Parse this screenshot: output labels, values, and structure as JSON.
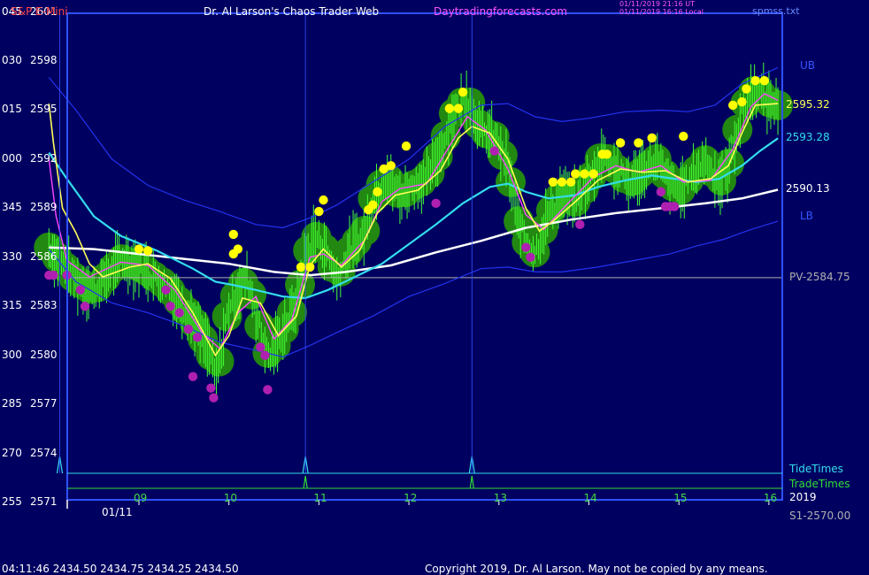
{
  "header": {
    "title_left": "S&P E-Mini",
    "title_center": "Dr. Al Larson's Chaos Trader Web",
    "title_site": "Daytradingforecasts.com",
    "timestamp_line1": "01/11/2019 21:16 UT",
    "timestamp_line2": "01/11/2019 16:16 Local",
    "filename": "spmss.txt"
  },
  "footer": {
    "quote": "04:11:46  2434.50  2434.75  2434.25  2434.50",
    "copyright": "Copyright 2019, Dr. Al Larson. May not be copied by any means."
  },
  "colors": {
    "background": "#000060",
    "frame": "#3050ff",
    "price_bars": "#44ff33",
    "halo": "#228811",
    "yellow_dots": "#ffff00",
    "magenta_dots": "#b020b0",
    "fast_ma": "#ffff55",
    "pink_ma": "#ff44ff",
    "cyan_ma": "#33ddee",
    "white_ma": "#ffffff",
    "bands": "#2233ee",
    "pivot": "#b0b0b0",
    "tide": "#33ddee",
    "trade": "#33dd33"
  },
  "chart_data": {
    "type": "line",
    "title": "S&P E-Mini",
    "y_axis": {
      "ticks": [
        {
          "left": "045",
          "right": "2601"
        },
        {
          "left": "030",
          "right": "2598"
        },
        {
          "left": "015",
          "right": "2595"
        },
        {
          "left": "000",
          "right": "2592"
        },
        {
          "left": "345",
          "right": "2589"
        },
        {
          "left": "330",
          "right": "2586"
        },
        {
          "left": "315",
          "right": "2583"
        },
        {
          "left": "300",
          "right": "2580"
        },
        {
          "left": "285",
          "right": "2577"
        },
        {
          "left": "270",
          "right": "2574"
        },
        {
          "left": "255",
          "right": "2571"
        }
      ],
      "range": [
        2571,
        2601
      ]
    },
    "x_axis": {
      "ticks": [
        {
          "label": "09",
          "value": 9
        },
        {
          "label": "10",
          "value": 10
        },
        {
          "label": "11",
          "value": 11
        },
        {
          "label": "12",
          "value": 12
        },
        {
          "label": "13",
          "value": 13
        },
        {
          "label": "14",
          "value": 14
        },
        {
          "label": "15",
          "value": 15
        },
        {
          "label": "16",
          "value": 16
        }
      ],
      "date_label": "01/11",
      "range": [
        8.0,
        16.1
      ]
    },
    "price_path": [
      [
        8.0,
        2586.6
      ],
      [
        8.3,
        2584.6
      ],
      [
        8.5,
        2583.9
      ],
      [
        8.8,
        2585.9
      ],
      [
        9.05,
        2585.3
      ],
      [
        9.3,
        2584.3
      ],
      [
        9.6,
        2582.2
      ],
      [
        9.8,
        2580.0
      ],
      [
        9.85,
        2578.4
      ],
      [
        10.0,
        2583.0
      ],
      [
        10.2,
        2584.8
      ],
      [
        10.35,
        2581.6
      ],
      [
        10.45,
        2579.8
      ],
      [
        10.6,
        2581.5
      ],
      [
        10.75,
        2583.2
      ],
      [
        10.85,
        2586.0
      ],
      [
        10.95,
        2587.4
      ],
      [
        11.1,
        2586.2
      ],
      [
        11.2,
        2584.6
      ],
      [
        11.35,
        2586.6
      ],
      [
        11.5,
        2587.4
      ],
      [
        11.6,
        2589.6
      ],
      [
        11.75,
        2591.0
      ],
      [
        11.9,
        2589.7
      ],
      [
        12.05,
        2590.4
      ],
      [
        12.2,
        2590.8
      ],
      [
        12.35,
        2592.5
      ],
      [
        12.5,
        2594.8
      ],
      [
        12.65,
        2595.9
      ],
      [
        12.8,
        2593.7
      ],
      [
        12.95,
        2593.4
      ],
      [
        13.1,
        2591.5
      ],
      [
        13.2,
        2588.5
      ],
      [
        13.3,
        2587.0
      ],
      [
        13.4,
        2586.3
      ],
      [
        13.55,
        2588.6
      ],
      [
        13.7,
        2589.9
      ],
      [
        13.85,
        2589.4
      ],
      [
        14.0,
        2590.6
      ],
      [
        14.15,
        2592.4
      ],
      [
        14.3,
        2591.4
      ],
      [
        14.45,
        2590.5
      ],
      [
        14.6,
        2591.3
      ],
      [
        14.75,
        2592.0
      ],
      [
        14.9,
        2590.5
      ],
      [
        15.0,
        2590.0
      ],
      [
        15.15,
        2591.0
      ],
      [
        15.3,
        2592.0
      ],
      [
        15.45,
        2590.5
      ],
      [
        15.55,
        2591.5
      ],
      [
        15.65,
        2593.8
      ],
      [
        15.75,
        2595.6
      ],
      [
        15.85,
        2596.3
      ],
      [
        16.0,
        2595.5
      ],
      [
        16.1,
        2595.3
      ]
    ],
    "series": [
      {
        "name": "Fast MA",
        "points": [
          [
            8.0,
            2595.4
          ],
          [
            8.05,
            2593.0
          ],
          [
            8.15,
            2589.0
          ],
          [
            8.3,
            2587.5
          ],
          [
            8.45,
            2585.6
          ],
          [
            8.6,
            2584.8
          ],
          [
            8.9,
            2585.4
          ],
          [
            9.1,
            2585.6
          ],
          [
            9.35,
            2584.7
          ],
          [
            9.6,
            2582.6
          ],
          [
            9.85,
            2580.0
          ],
          [
            10.0,
            2581.2
          ],
          [
            10.15,
            2583.5
          ],
          [
            10.35,
            2583.2
          ],
          [
            10.55,
            2581.2
          ],
          [
            10.75,
            2582.4
          ],
          [
            10.9,
            2585.5
          ],
          [
            11.05,
            2586.5
          ],
          [
            11.25,
            2585.4
          ],
          [
            11.45,
            2586.4
          ],
          [
            11.65,
            2588.7
          ],
          [
            11.85,
            2589.8
          ],
          [
            12.1,
            2590.1
          ],
          [
            12.35,
            2591.3
          ],
          [
            12.55,
            2593.3
          ],
          [
            12.7,
            2594.0
          ],
          [
            12.9,
            2593.6
          ],
          [
            13.1,
            2592.0
          ],
          [
            13.3,
            2589.0
          ],
          [
            13.45,
            2587.6
          ],
          [
            13.6,
            2588.2
          ],
          [
            13.85,
            2589.4
          ],
          [
            14.1,
            2590.7
          ],
          [
            14.35,
            2591.4
          ],
          [
            14.6,
            2591.2
          ],
          [
            14.85,
            2591.3
          ],
          [
            15.1,
            2590.6
          ],
          [
            15.35,
            2590.8
          ],
          [
            15.55,
            2591.6
          ],
          [
            15.7,
            2593.6
          ],
          [
            15.85,
            2595.3
          ],
          [
            16.1,
            2595.4
          ]
        ]
      },
      {
        "name": "Pink MA",
        "points": [
          [
            8.0,
            2592.0
          ],
          [
            8.08,
            2588.5
          ],
          [
            8.2,
            2585.8
          ],
          [
            8.45,
            2584.8
          ],
          [
            8.8,
            2585.7
          ],
          [
            9.1,
            2585.5
          ],
          [
            9.4,
            2584.0
          ],
          [
            9.7,
            2581.4
          ],
          [
            9.9,
            2580.4
          ],
          [
            10.1,
            2582.6
          ],
          [
            10.3,
            2583.6
          ],
          [
            10.5,
            2581.0
          ],
          [
            10.7,
            2582.2
          ],
          [
            10.9,
            2586.0
          ],
          [
            11.05,
            2586.2
          ],
          [
            11.25,
            2585.5
          ],
          [
            11.5,
            2587.0
          ],
          [
            11.7,
            2589.4
          ],
          [
            11.9,
            2590.2
          ],
          [
            12.2,
            2590.5
          ],
          [
            12.45,
            2592.8
          ],
          [
            12.65,
            2594.6
          ],
          [
            12.85,
            2593.8
          ],
          [
            13.1,
            2591.4
          ],
          [
            13.3,
            2588.6
          ],
          [
            13.5,
            2587.7
          ],
          [
            13.75,
            2589.2
          ],
          [
            14.05,
            2590.9
          ],
          [
            14.3,
            2591.6
          ],
          [
            14.55,
            2591.2
          ],
          [
            14.8,
            2591.6
          ],
          [
            15.05,
            2590.6
          ],
          [
            15.35,
            2590.7
          ],
          [
            15.6,
            2592.6
          ],
          [
            15.8,
            2595.2
          ],
          [
            15.95,
            2596.0
          ],
          [
            16.1,
            2595.6
          ]
        ]
      },
      {
        "name": "Cyan MA",
        "points": [
          [
            8.0,
            2592.4
          ],
          [
            8.2,
            2590.8
          ],
          [
            8.5,
            2588.5
          ],
          [
            8.8,
            2587.3
          ],
          [
            9.2,
            2586.4
          ],
          [
            9.6,
            2585.3
          ],
          [
            9.85,
            2584.5
          ],
          [
            10.05,
            2584.3
          ],
          [
            10.3,
            2584.0
          ],
          [
            10.6,
            2583.6
          ],
          [
            10.85,
            2583.5
          ],
          [
            11.1,
            2584.0
          ],
          [
            11.4,
            2584.8
          ],
          [
            11.7,
            2585.6
          ],
          [
            12.0,
            2586.8
          ],
          [
            12.3,
            2588.0
          ],
          [
            12.6,
            2589.3
          ],
          [
            12.9,
            2590.3
          ],
          [
            13.1,
            2590.5
          ],
          [
            13.3,
            2590.0
          ],
          [
            13.55,
            2589.6
          ],
          [
            13.85,
            2589.8
          ],
          [
            14.1,
            2590.3
          ],
          [
            14.4,
            2590.7
          ],
          [
            14.7,
            2591.0
          ],
          [
            14.95,
            2590.8
          ],
          [
            15.2,
            2590.6
          ],
          [
            15.45,
            2590.8
          ],
          [
            15.7,
            2591.6
          ],
          [
            15.9,
            2592.5
          ],
          [
            16.1,
            2593.28
          ]
        ]
      },
      {
        "name": "White MA",
        "points": [
          [
            8.0,
            2586.6
          ],
          [
            8.5,
            2586.5
          ],
          [
            9.0,
            2586.2
          ],
          [
            9.5,
            2585.9
          ],
          [
            10.0,
            2585.6
          ],
          [
            10.5,
            2585.1
          ],
          [
            10.9,
            2584.9
          ],
          [
            11.3,
            2585.1
          ],
          [
            11.8,
            2585.5
          ],
          [
            12.3,
            2586.3
          ],
          [
            12.8,
            2587.0
          ],
          [
            13.3,
            2587.8
          ],
          [
            13.8,
            2588.3
          ],
          [
            14.3,
            2588.7
          ],
          [
            14.8,
            2589.0
          ],
          [
            15.3,
            2589.3
          ],
          [
            15.7,
            2589.6
          ],
          [
            16.1,
            2590.13
          ]
        ]
      },
      {
        "name": "UB",
        "points": [
          [
            8.0,
            2597.0
          ],
          [
            8.3,
            2595.0
          ],
          [
            8.7,
            2592.0
          ],
          [
            9.1,
            2590.4
          ],
          [
            9.5,
            2589.5
          ],
          [
            9.9,
            2588.8
          ],
          [
            10.3,
            2588.0
          ],
          [
            10.6,
            2587.8
          ],
          [
            10.9,
            2588.4
          ],
          [
            11.2,
            2589.2
          ],
          [
            11.6,
            2590.6
          ],
          [
            12.0,
            2592.0
          ],
          [
            12.4,
            2594.0
          ],
          [
            12.8,
            2595.3
          ],
          [
            13.1,
            2595.4
          ],
          [
            13.4,
            2594.6
          ],
          [
            13.7,
            2594.3
          ],
          [
            14.0,
            2594.5
          ],
          [
            14.4,
            2594.9
          ],
          [
            14.8,
            2595.0
          ],
          [
            15.1,
            2594.9
          ],
          [
            15.4,
            2595.3
          ],
          [
            15.7,
            2596.6
          ],
          [
            16.1,
            2597.6
          ]
        ]
      },
      {
        "name": "LB",
        "points": [
          [
            8.0,
            2586.5
          ],
          [
            8.3,
            2584.5
          ],
          [
            8.7,
            2583.2
          ],
          [
            9.1,
            2582.6
          ],
          [
            9.5,
            2581.8
          ],
          [
            9.9,
            2580.8
          ],
          [
            10.3,
            2580.3
          ],
          [
            10.6,
            2579.9
          ],
          [
            10.9,
            2580.6
          ],
          [
            11.2,
            2581.4
          ],
          [
            11.6,
            2582.4
          ],
          [
            12.0,
            2583.6
          ],
          [
            12.4,
            2584.4
          ],
          [
            12.8,
            2585.3
          ],
          [
            13.1,
            2585.4
          ],
          [
            13.4,
            2585.1
          ],
          [
            13.7,
            2585.1
          ],
          [
            14.1,
            2585.4
          ],
          [
            14.5,
            2585.8
          ],
          [
            14.9,
            2586.2
          ],
          [
            15.2,
            2586.7
          ],
          [
            15.5,
            2587.1
          ],
          [
            15.8,
            2587.7
          ],
          [
            16.1,
            2588.2
          ]
        ]
      }
    ],
    "pivot_line": {
      "label": "PV-2584.75",
      "value": 2584.75
    },
    "right_labels": [
      {
        "text": "UB",
        "value": 2597.7
      },
      {
        "text": "2595.32",
        "value": 2595.32
      },
      {
        "text": "2593.28",
        "value": 2593.28
      },
      {
        "text": "2590.13",
        "value": 2590.13
      },
      {
        "text": "LB",
        "value": 2588.5
      }
    ],
    "tide_times": {
      "label": "TideTimes",
      "spikes": [
        8.12,
        10.85,
        12.7
      ]
    },
    "trade_times": {
      "label": "TradeTimes",
      "year_label": "2019",
      "spikes": [
        10.85,
        12.7
      ]
    },
    "support_label": "S1-2570.00",
    "yellow_dots": [
      [
        9.0,
        2586.5
      ],
      [
        9.1,
        2586.4
      ],
      [
        10.05,
        2586.2
      ],
      [
        10.1,
        2586.5
      ],
      [
        10.05,
        2587.4
      ],
      [
        10.8,
        2585.4
      ],
      [
        10.9,
        2585.4
      ],
      [
        11.0,
        2588.8
      ],
      [
        11.05,
        2589.5
      ],
      [
        11.55,
        2588.9
      ],
      [
        11.6,
        2589.2
      ],
      [
        11.65,
        2590.0
      ],
      [
        11.72,
        2591.4
      ],
      [
        11.8,
        2591.6
      ],
      [
        11.97,
        2592.8
      ],
      [
        12.45,
        2595.1
      ],
      [
        12.55,
        2595.1
      ],
      [
        12.6,
        2596.1
      ],
      [
        13.6,
        2590.6
      ],
      [
        13.7,
        2590.6
      ],
      [
        13.8,
        2590.6
      ],
      [
        13.85,
        2591.1
      ],
      [
        13.95,
        2591.1
      ],
      [
        14.05,
        2591.1
      ],
      [
        14.15,
        2592.3
      ],
      [
        14.2,
        2592.3
      ],
      [
        14.35,
        2593.0
      ],
      [
        14.55,
        2593.0
      ],
      [
        14.7,
        2593.3
      ],
      [
        15.05,
        2593.4
      ],
      [
        15.6,
        2595.3
      ],
      [
        15.7,
        2595.5
      ],
      [
        15.75,
        2596.3
      ],
      [
        15.85,
        2596.8
      ],
      [
        15.95,
        2596.8
      ]
    ],
    "magenta_dots": [
      [
        8.0,
        2584.9
      ],
      [
        8.05,
        2584.9
      ],
      [
        8.2,
        2584.9
      ],
      [
        8.35,
        2584.0
      ],
      [
        8.4,
        2583.0
      ],
      [
        9.3,
        2584.0
      ],
      [
        9.35,
        2583.0
      ],
      [
        9.45,
        2582.6
      ],
      [
        9.55,
        2581.6
      ],
      [
        9.65,
        2581.1
      ],
      [
        9.6,
        2578.7
      ],
      [
        9.8,
        2578.0
      ],
      [
        9.83,
        2577.4
      ],
      [
        10.35,
        2580.5
      ],
      [
        10.4,
        2580.0
      ],
      [
        10.43,
        2577.9
      ],
      [
        12.3,
        2589.3
      ],
      [
        12.95,
        2592.5
      ],
      [
        13.3,
        2586.6
      ],
      [
        13.35,
        2586.0
      ],
      [
        13.9,
        2588.0
      ],
      [
        14.8,
        2590.0
      ],
      [
        14.85,
        2589.1
      ],
      [
        14.9,
        2589.1
      ],
      [
        14.95,
        2589.1
      ]
    ]
  }
}
